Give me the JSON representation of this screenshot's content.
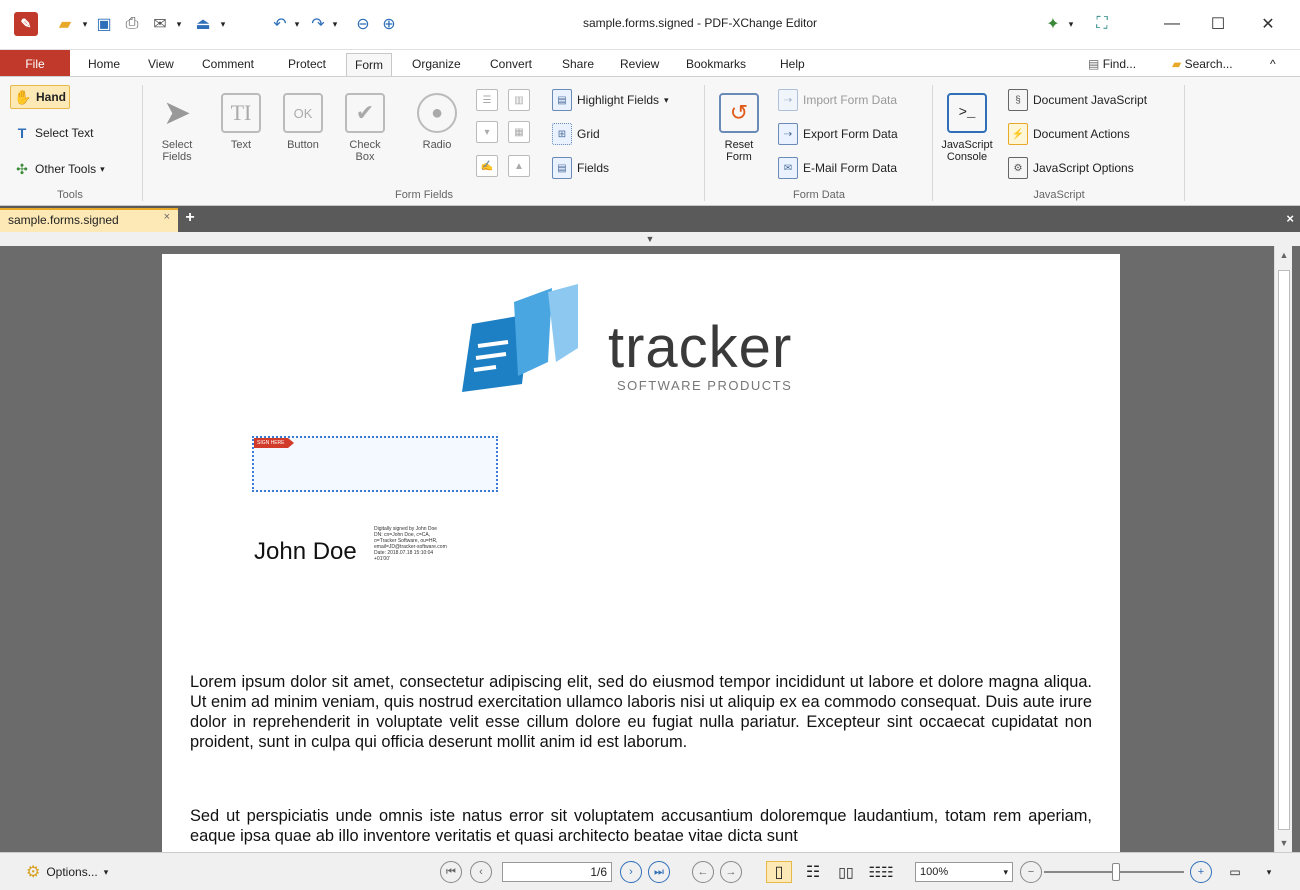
{
  "window": {
    "title": "sample.forms.signed - PDF-XChange Editor",
    "controls": [
      "—",
      "☐",
      "✕"
    ]
  },
  "menu": {
    "file": "File",
    "tabs": [
      "Home",
      "View",
      "Comment",
      "Protect",
      "Form",
      "Organize",
      "Convert",
      "Share",
      "Review",
      "Bookmarks",
      "Help"
    ],
    "active_tab": "Form",
    "find": "Find...",
    "search": "Search...",
    "collapse_symbol": "^"
  },
  "ribbon": {
    "tools": {
      "label": "Tools",
      "hand": "Hand",
      "select_text": "Select Text",
      "other_tools": "Other Tools"
    },
    "form_fields": {
      "label": "Form Fields",
      "select_fields": [
        "Select",
        "Fields"
      ],
      "text": "Text",
      "button": "Button",
      "check_box": [
        "Check",
        "Box"
      ],
      "radio": "Radio",
      "highlight_fields": "Highlight Fields",
      "grid": "Grid",
      "fields": "Fields"
    },
    "form_data": {
      "label": "Form Data",
      "reset_form": [
        "Reset",
        "Form"
      ],
      "import": "Import Form Data",
      "export": "Export Form Data",
      "email": "E-Mail Form Data"
    },
    "javascript": {
      "label": "JavaScript",
      "console": [
        "JavaScript",
        "Console"
      ],
      "document_js": "Document JavaScript",
      "document_actions": "Document Actions",
      "js_options": "JavaScript Options"
    }
  },
  "doc_tab": {
    "name": "sample.forms.signed",
    "close": "×",
    "new": "+",
    "close_all": "×"
  },
  "document": {
    "logo_word": "tracker",
    "logo_sub": "SOFTWARE PRODUCTS",
    "sig_flag": "SIGN HERE",
    "signer": "John Doe",
    "sig_details": [
      "Digitally signed by John Doe",
      "DN: cn=John Doe, c=CA,",
      "o=Tracker Software, ou=HR,",
      "email=JD@tracker-software.com",
      "Date: 2018.07.18 15:10:04",
      "+01'00'"
    ],
    "para1": "Lorem ipsum dolor sit amet, consectetur adipiscing elit, sed do eiusmod tempor incididunt ut labore et dolore magna aliqua. Ut enim ad minim veniam, quis nostrud exercitation ullamco laboris nisi ut aliquip ex ea commodo consequat. Duis aute irure dolor in reprehenderit in voluptate velit esse cillum dolore eu fugiat nulla pariatur. Excepteur sint occaecat cupidatat non proident, sunt in culpa qui officia deserunt mollit anim id est laborum.",
    "para2": "Sed ut perspiciatis unde omnis iste natus error sit voluptatem accusantium doloremque laudantium, totam rem aperiam, eaque ipsa quae ab illo inventore veritatis et quasi architecto beatae vitae dicta sunt"
  },
  "statusbar": {
    "options": "Options...",
    "page": "1/6",
    "zoom": "100%"
  },
  "colors": {
    "file_tab": "#c0392b",
    "selected_tool": "#fde9b6",
    "doc_background": "#6b6b6b",
    "signature_field_border": "#3b7bd6"
  }
}
